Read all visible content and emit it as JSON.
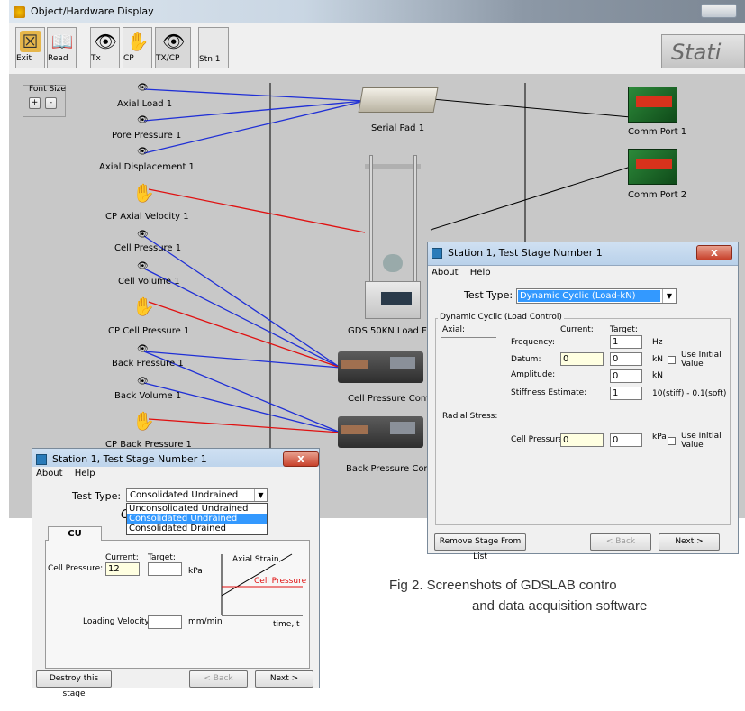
{
  "main_window": {
    "title": "Object/Hardware Display",
    "header_logo": "Stati"
  },
  "toolbar": [
    {
      "label": "Exit",
      "icon": "exit-icon"
    },
    {
      "label": "Read",
      "icon": "book-icon"
    },
    {
      "label": "Tx",
      "icon": "eye-icon"
    },
    {
      "label": "CP",
      "icon": "hand-icon"
    },
    {
      "label": "TX/CP",
      "icon": "eye-hand-icon"
    }
  ],
  "station_tab": "Stn 1",
  "font_size": {
    "label": "Font Size",
    "plus": "+",
    "minus": "-"
  },
  "transducers": {
    "axial_load": "Axial Load 1",
    "pore_pressure": "Pore Pressure 1",
    "axial_displacement": "Axial Displacement 1",
    "cp_axial_velocity": "CP Axial Velocity 1",
    "cell_pressure": "Cell Pressure 1",
    "cell_volume": "Cell Volume 1",
    "cp_cell_pressure": "CP Cell Pressure 1",
    "back_pressure": "Back Pressure 1",
    "back_volume": "Back Volume 1",
    "cp_back_pressure": "CP Back Pressure 1"
  },
  "devices": {
    "serial_pad": "Serial Pad 1",
    "load_frame": "GDS 50KN Load F",
    "cell_pressure_controller": "Cell Pressure Cont",
    "back_pressure_controller": "Back Pressure Con",
    "comm_port_1": "Comm Port 1",
    "comm_port_2": "Comm Port 2"
  },
  "dialog_dynamic": {
    "title": "Station 1, Test Stage Number 1",
    "close": "x",
    "menu": [
      "About",
      "Help"
    ],
    "test_type_label": "Test Type:",
    "test_type_value": "Dynamic Cyclic (Load-kN)",
    "group_label": "Dynamic Cyclic (Load Control)",
    "axial_label": "Axial:",
    "current_header": "Current:",
    "target_header": "Target:",
    "frequency_label": "Frequency:",
    "frequency_target": "1",
    "frequency_unit": "Hz",
    "datum_label": "Datum:",
    "datum_current": "0",
    "datum_target": "0",
    "datum_unit": "kN",
    "use_initial_value": "Use Initial Value",
    "amplitude_label": "Amplitude:",
    "amplitude_target": "0",
    "amplitude_unit": "kN",
    "stiffness_label": "Stiffness Estimate:",
    "stiffness_target": "1",
    "stiffness_unit": "10(stiff) - 0.1(soft)",
    "radial_label": "Radial Stress:",
    "cell_pressure_label": "Cell Pressure:",
    "cell_pressure_current": "0",
    "cell_pressure_target": "0",
    "cell_pressure_unit": "kPa",
    "use_initial_value_2": "Use Initial Value",
    "remove_button": "Remove Stage From List",
    "back_button": "< Back",
    "next_button": "Next >"
  },
  "dialog_cu": {
    "title": "Station 1, Test Stage Number 1",
    "close": "x",
    "menu": [
      "About",
      "Help"
    ],
    "test_type_label": "Test Type:",
    "test_type_value": "Consolidated Undrained",
    "behind_text": "Co",
    "options": [
      "Unconsolidated Undrained",
      "Consolidated Undrained",
      "Consolidated Drained"
    ],
    "selected_option": "Consolidated Undrained",
    "tab_label": "CU",
    "current_header": "Current:",
    "target_header": "Target:",
    "cell_pressure_label": "Cell Pressure:",
    "cell_pressure_current": "12",
    "cell_pressure_unit": "kPa",
    "loading_velocity_label": "Loading Velocity:",
    "loading_velocity_unit": "mm/min",
    "legend_axial_strain": "Axial Strain",
    "legend_cell_pressure": "Cell Pressure",
    "time_label": "time, t",
    "destroy_button": "Destroy this stage",
    "back_button": "< Back",
    "next_button": "Next >"
  },
  "caption": {
    "line1": "Fig 2. Screenshots of GDSLAB contro",
    "line2": "and data acquisition software"
  },
  "colors": {
    "blue_link": "#1f2fd6",
    "red_link": "#e01010",
    "black_link": "#000000",
    "selection": "#3399ff",
    "input_yellow": "#ffffe1"
  }
}
